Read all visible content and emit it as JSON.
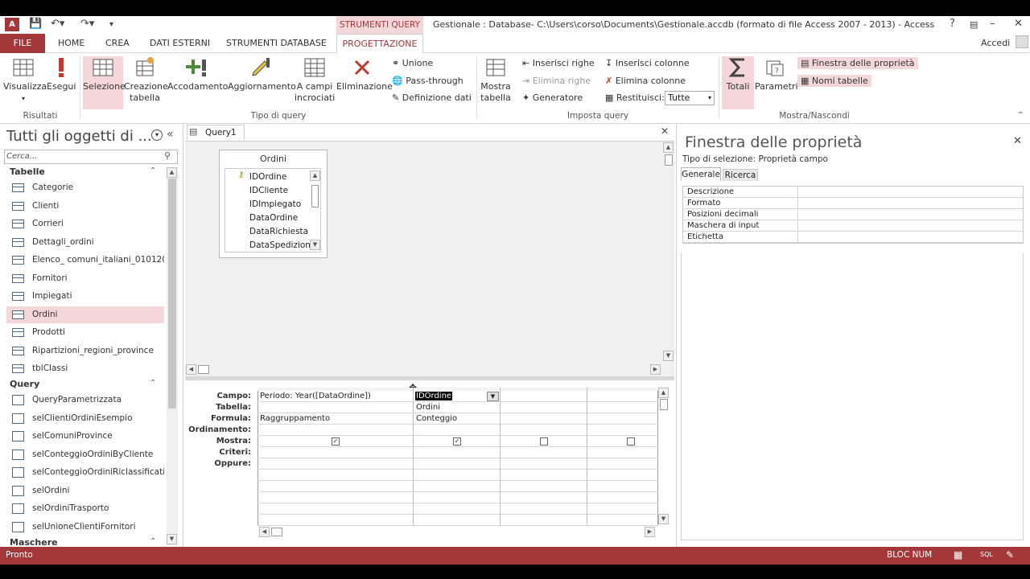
{
  "title_bar": {
    "app_icon": "A",
    "context_tab": "STRUMENTI QUERY",
    "window_title": "Gestionale : Database- C:\\Users\\corso\\Documents\\Gestionale.accdb (formato di file Access 2007 - 2013) - Access",
    "help": "?"
  },
  "tabs": {
    "file": "FILE",
    "home": "HOME",
    "crea": "CREA",
    "dati_esterni": "DATI ESTERNI",
    "strumenti_database": "STRUMENTI DATABASE",
    "progettazione": "PROGETTAZIONE",
    "accedi": "Accedi"
  },
  "ribbon": {
    "visualizza": "Visualizza",
    "esegui": "Esegui",
    "selezione": "Selezione",
    "creazione_tabella": "Creazione tabella",
    "accodamento": "Accodamento",
    "aggiornamento": "Aggiornamento",
    "a_campi_incrociati": "A campi incrociati",
    "eliminazione": "Eliminazione",
    "unione": "Unione",
    "pass_through": "Pass-through",
    "definizione_dati": "Definizione dati",
    "mostra_tabella": "Mostra tabella",
    "inserisci_righe": "Inserisci righe",
    "elimina_righe": "Elimina righe",
    "generatore": "Generatore",
    "inserisci_colonne": "Inserisci colonne",
    "elimina_colonne": "Elimina colonne",
    "restituisci": "Restituisci:",
    "restituisci_value": "Tutte",
    "totali": "Totali",
    "parametri": "Parametri",
    "finestra_proprieta": "Finestra delle proprietà",
    "nomi_tabelle": "Nomi tabelle",
    "groups": {
      "risultati": "Risultati",
      "tipo_query": "Tipo di query",
      "imposta_query": "Imposta query",
      "mostra_nascondi": "Mostra/Nascondi"
    }
  },
  "nav": {
    "title": "Tutti gli oggetti di ...",
    "search_placeholder": "Cerca...",
    "tabelle_header": "Tabelle",
    "tabelle": [
      "Categorie",
      "Clienti",
      "Corrieri",
      "Dettagli_ordini",
      "Elenco_ comuni_italiani_010120...",
      "Fornitori",
      "Impiegati",
      "Ordini",
      "Prodotti",
      "Ripartizioni_regioni_province",
      "tblClassi"
    ],
    "query_header": "Query",
    "query": [
      "QueryParametrizzata",
      "selClientiOrdiniEsempio",
      "selComuniProvince",
      "selConteggioOrdiniByCliente",
      "selConteggioOrdiniRiclassificati",
      "selOrdini",
      "selOrdiniTrasporto",
      "selUnioneClientiFornitori"
    ],
    "maschere_header": "Maschere"
  },
  "query": {
    "tab_label": "Query1",
    "table_name": "Ordini",
    "fields": [
      "IDOrdine",
      "IDCliente",
      "IDImpiegato",
      "DataOrdine",
      "DataRichiesta",
      "DataSpedizione"
    ],
    "row_labels": [
      "Campo:",
      "Tabella:",
      "Formula:",
      "Ordinamento:",
      "Mostra:",
      "Criteri:",
      "Oppure:"
    ],
    "col1": {
      "campo": "Periodo: Year([DataOrdine])",
      "tabella": "",
      "formula": "Raggruppamento"
    },
    "col2": {
      "campo": "IDOrdine",
      "tabella": "Ordini",
      "formula": "Conteggio"
    }
  },
  "props": {
    "title": "Finestra delle proprietà",
    "selection_type": "Tipo di selezione:  Proprietà campo",
    "tab_generale": "Generale",
    "tab_ricerca": "Ricerca",
    "rows": [
      "Descrizione",
      "Formato",
      "Posizioni decimali",
      "Maschera di input",
      "Etichetta"
    ]
  },
  "status": {
    "left": "Pronto",
    "bloc_num": "BLOC NUM",
    "sql": "SQL"
  },
  "colors": {
    "accent": "#a4373a",
    "selected_bg": "#f4d7d9"
  }
}
